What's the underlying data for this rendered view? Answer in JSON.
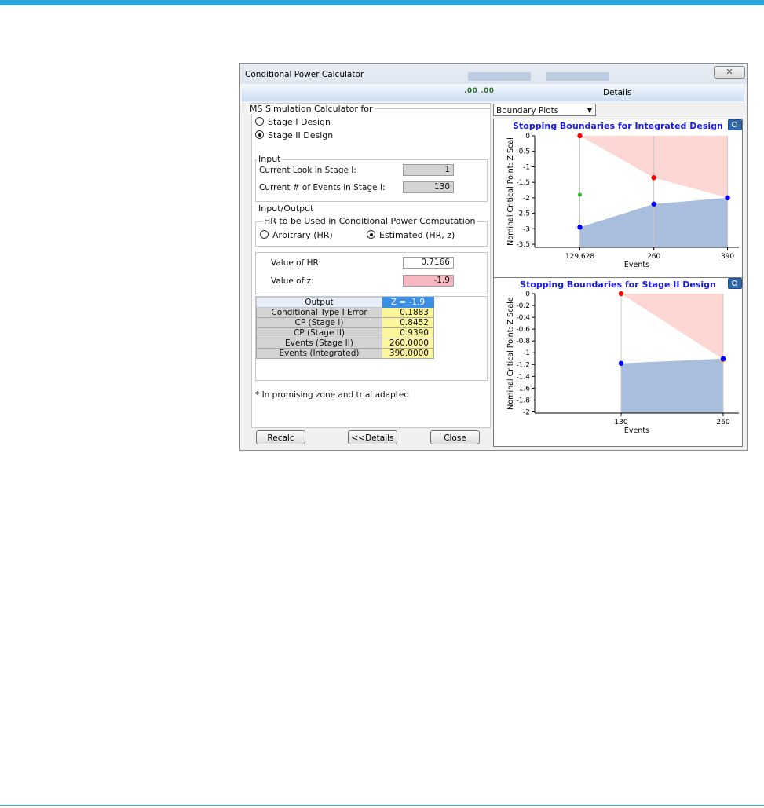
{
  "window": {
    "title": "Conditional Power Calculator",
    "close_glyph": "✕",
    "details_icons": ".00 .00",
    "details_label": "Details"
  },
  "calculator": {
    "group_label": "MS Simulation Calculator for",
    "options": [
      "Stage I Design",
      "Stage II Design"
    ],
    "selected": "Stage II Design"
  },
  "input": {
    "group_label": "Input",
    "current_look_label": "Current Look in Stage I:",
    "current_look_value": "1",
    "current_events_label": "Current # of Events in Stage I:",
    "current_events_value": "130"
  },
  "input_output": {
    "group_label": "Input/Output",
    "hr_group_label": "HR to be Used in Conditional Power Computation",
    "option_arbitrary": "Arbitrary  (HR)",
    "option_estimated": "Estimated  (HR, z)",
    "selected": "Estimated",
    "hr_label": "Value of HR:",
    "hr_value": "0.7166",
    "z_label": "Value of z:",
    "z_value": "-1.9"
  },
  "output_table": {
    "header": "Output",
    "column": "Z = -1.9",
    "rows": [
      {
        "label": "Conditional Type I Error",
        "value": "0.1883"
      },
      {
        "label": "CP (Stage I)",
        "value": "0.8452"
      },
      {
        "label": "CP (Stage II)",
        "value": "0.9390"
      },
      {
        "label": "Events (Stage II)",
        "value": "260.0000"
      },
      {
        "label": "Events (Integrated)",
        "value": "390.0000"
      }
    ]
  },
  "note": "* In promising zone and trial adapted",
  "buttons": {
    "recalc": "Recalc",
    "details": "<<Details",
    "close": "Close"
  },
  "plot_selector": {
    "value": "Boundary Plots"
  },
  "colors": {
    "efficacy_region": "#fcd7d4",
    "futility_region": "#a8bedc",
    "efficacy_point": "#ff0000",
    "futility_point": "#0000ff",
    "observed_point": "#33bb33",
    "title_color": "#1a1adc"
  },
  "chart_data": [
    {
      "type": "scatter",
      "title": "Stopping Boundaries for Integrated Design",
      "xlabel": "Events",
      "ylabel": "Nominal Critical Point:  Z Scal",
      "x_ticks": [
        129.628,
        260,
        390
      ],
      "x_tick_labels": [
        "129.628",
        "260",
        "390"
      ],
      "y_ticks": [
        0,
        -0.5,
        -1,
        -1.5,
        -2,
        -2.5,
        -3,
        -3.5
      ],
      "y_tick_labels": [
        "0",
        "-0.5",
        "-1",
        "-1.5",
        "-2",
        "-2.5",
        "-3",
        "-3.5"
      ],
      "xlim": [
        50,
        410
      ],
      "ylim": [
        -3.6,
        0
      ],
      "series": [
        {
          "role": "efficacy",
          "x": [
            129.628,
            260,
            390
          ],
          "y": [
            0,
            -1.35,
            -2.0
          ]
        },
        {
          "role": "futility",
          "x": [
            129.628,
            260,
            390
          ],
          "y": [
            -2.95,
            -2.2,
            -2.0
          ]
        },
        {
          "role": "observed",
          "x": [
            129.628
          ],
          "y": [
            -1.9
          ]
        }
      ]
    },
    {
      "type": "scatter",
      "title": "Stopping Boundaries for Stage II Design",
      "xlabel": "Events",
      "ylabel": "Nominal Critical Point:  Z Scale",
      "x_ticks": [
        130,
        260
      ],
      "x_tick_labels": [
        "130",
        "260"
      ],
      "y_ticks": [
        0,
        -0.2,
        -0.4,
        -0.6,
        -0.8,
        -1,
        -1.2,
        -1.4,
        -1.6,
        -1.8,
        -2
      ],
      "y_tick_labels": [
        "0",
        "-0.2",
        "-0.4",
        "-0.6",
        "-0.8",
        "-1",
        "-1.2",
        "-1.4",
        "-1.6",
        "-1.8",
        "-2"
      ],
      "xlim": [
        20,
        280
      ],
      "ylim": [
        -2.02,
        0
      ],
      "series": [
        {
          "role": "efficacy",
          "x": [
            130,
            260
          ],
          "y": [
            0,
            -1.11
          ]
        },
        {
          "role": "futility",
          "x": [
            130,
            260
          ],
          "y": [
            -1.18,
            -1.1
          ]
        }
      ]
    }
  ]
}
